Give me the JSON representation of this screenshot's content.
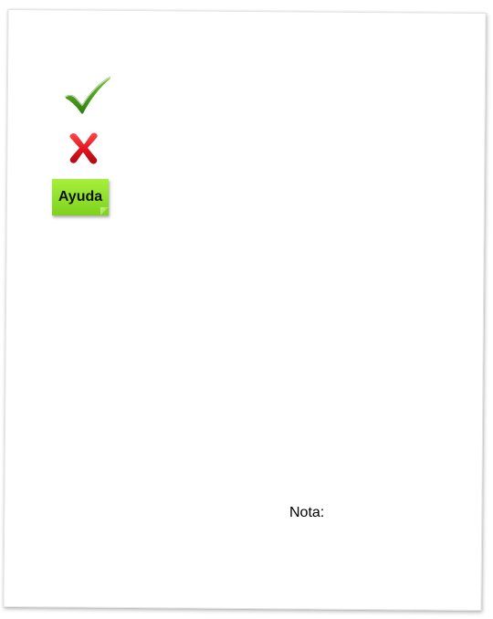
{
  "icons": {
    "accept": "check-icon",
    "reject": "cross-icon"
  },
  "help_button": {
    "label": "Ayuda",
    "color": "#8fe02a"
  },
  "note": {
    "label": "Nota:"
  },
  "colors": {
    "check": "#4a9a1c",
    "cross": "#e0141e"
  }
}
